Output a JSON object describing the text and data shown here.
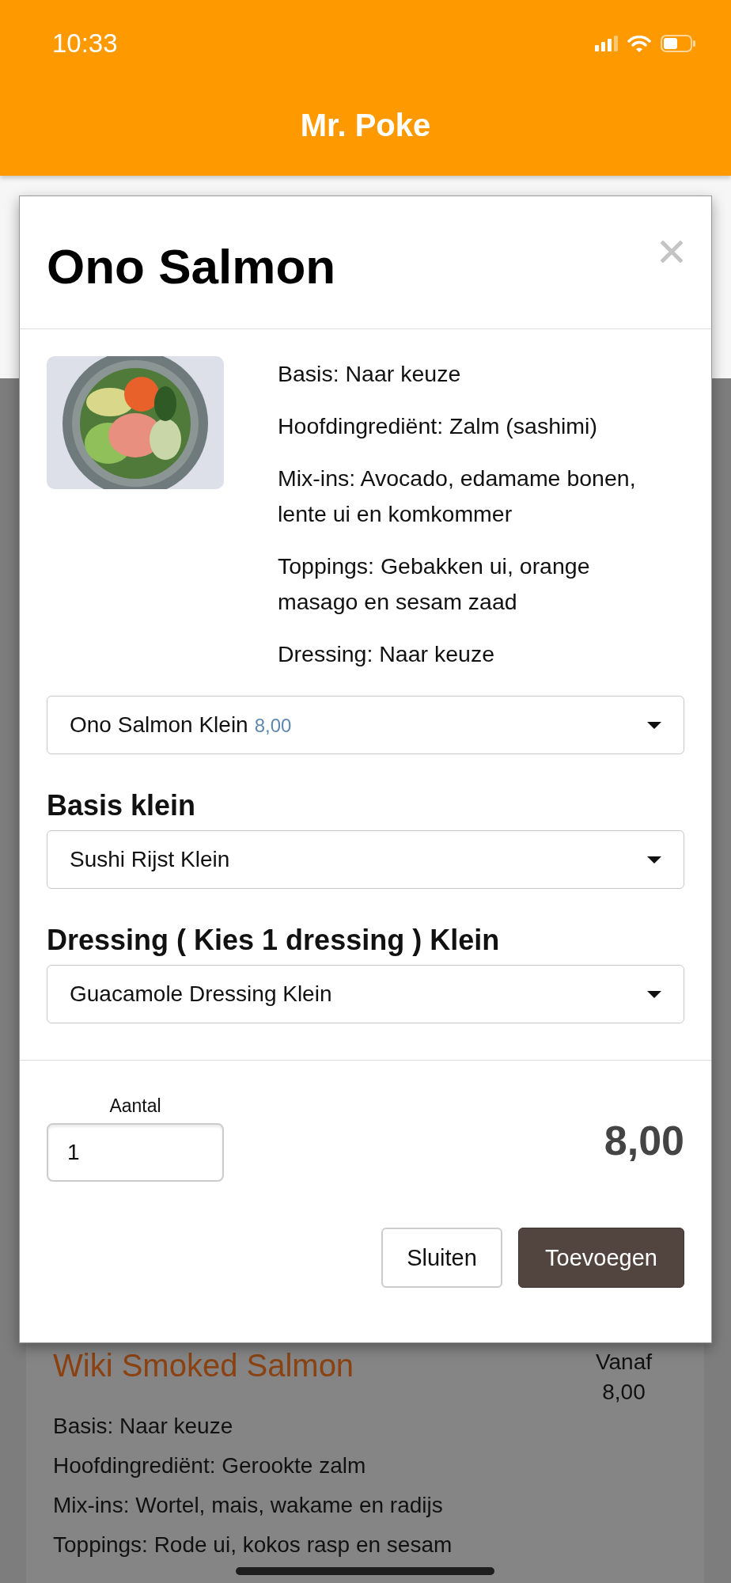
{
  "status_bar": {
    "time": "10:33"
  },
  "header": {
    "title": "Mr. Poke"
  },
  "modal": {
    "title": "Ono Salmon",
    "description": [
      "Basis: Naar keuze",
      "Hoofdingrediënt: Zalm (sashimi)",
      "Mix-ins: Avocado, edamame bonen, lente ui en komkommer",
      "Toppings: Gebakken ui, orange masago en sesam zaad",
      "Dressing: Naar keuze"
    ],
    "size_select": {
      "value": "Ono Salmon Klein",
      "price": "8,00"
    },
    "options": [
      {
        "label": "Basis klein",
        "value": "Sushi Rijst Klein"
      },
      {
        "label": "Dressing ( Kies 1 dressing ) Klein",
        "value": "Guacamole Dressing Klein"
      }
    ],
    "quantity": {
      "label": "Aantal",
      "value": "1"
    },
    "total": "8,00",
    "buttons": [
      {
        "label": "Sluiten",
        "kind": "secondary"
      },
      {
        "label": "Toevoegen",
        "kind": "primary"
      }
    ]
  },
  "background_item": {
    "title": "Wiki Smoked Salmon",
    "price_prefix": "Vanaf",
    "price": "8,00",
    "lines": [
      "Basis: Naar keuze",
      "Hoofdingrediënt: Gerookte zalm",
      "Mix-ins: Wortel, mais, wakame en radijs",
      "Toppings: Rode ui, kokos rasp en sesam"
    ]
  }
}
